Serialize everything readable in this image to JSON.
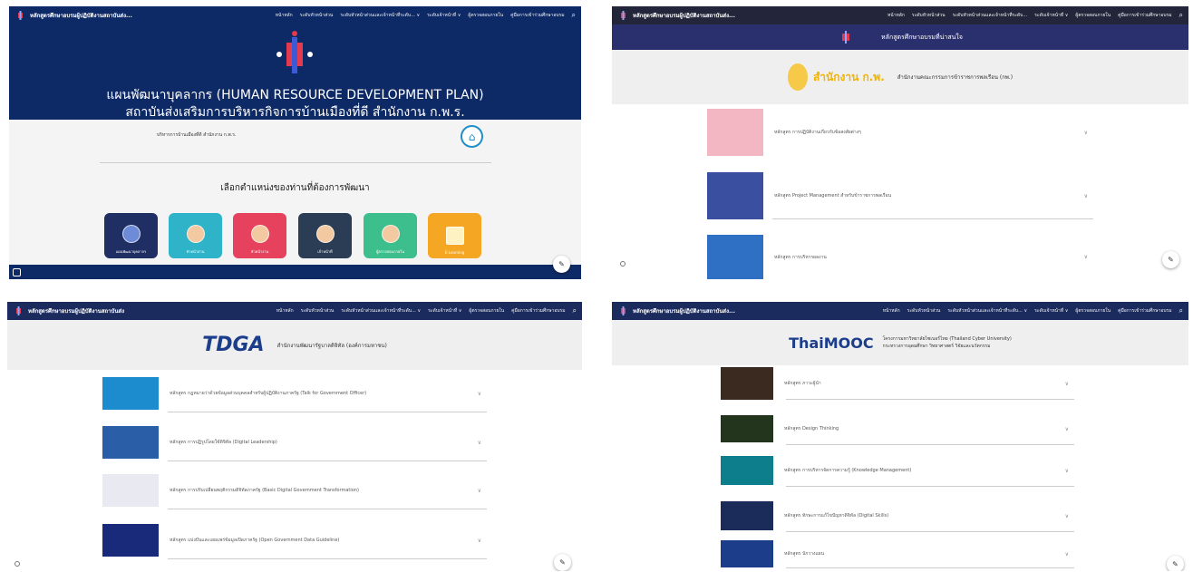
{
  "colors": {
    "hero": "#0e2a66",
    "accent_blue": "#1e8fc7"
  },
  "p1": {
    "site_title": "หลักสูตรศึกษาอบรมผู้ปฏิบัติงานสถาบันส่ง...",
    "nav": [
      "หน้าหลัก",
      "ระดับหัวหน้าส่วน",
      "ระดับหัวหน้าส่วนและเจ้าหน้าที่ระดับ... ∨",
      "ระดับเจ้าหน้าที่ ∨",
      "ผู้ตรวจสอบภายใน",
      "คู่มือการเข้าร่วมศึกษาอบรม"
    ],
    "hero_title": "แผนพัฒนาบุคลากร (HUMAN RESOURCE DEVELOPMENT PLAN)",
    "hero_subtitle": "สถาบันส่งเสริมการบริหารกิจการบ้านเมืองที่ดี สำนักงาน ก.พ.ร.",
    "breadcrumb": "บริหารการบ้านเมืองที่ดี สำนักงาน ก.พ.ร.",
    "pick_title": "เลือกตำแหน่งของท่านที่ต้องการพัฒนา",
    "cards": [
      {
        "label": "แผนพัฒนาบุคลากร",
        "color": "#1f2e63"
      },
      {
        "label": "หัวหน้าส่วน",
        "color": "#2fb3c9"
      },
      {
        "label": "หัวหน้างาน",
        "color": "#e6425e"
      },
      {
        "label": "เจ้าหน้าที่",
        "color": "#2a3d55"
      },
      {
        "label": "ผู้ตรวจสอบภายใน",
        "color": "#3cbf8c"
      },
      {
        "label": "E-Learning",
        "color": "#f5a623"
      }
    ]
  },
  "p2": {
    "site_title": "หลักสูตรศึกษาอบรมผู้ปฏิบัติงานสถาบันส่ง...",
    "nav": [
      "หน้าหลัก",
      "ระดับหัวหน้าส่วน",
      "ระดับหัวหน้าส่วนและเจ้าหน้าที่ระดับ...",
      "ระดับเจ้าหน้าที่ ∨",
      "ผู้ตรวจสอบภายใน",
      "คู่มือการเข้าร่วมศึกษาอบรม"
    ],
    "band_title": "หลักสูตรศึกษาอบรมที่น่าสนใจ",
    "ocsc_logo": "สำนักงาน ก.พ.",
    "org_name": "สำนักงานคณะกรรมการข้าราชการพลเรือน (กพ.)",
    "rows": [
      {
        "title": "หลักสูตร การปฏิบัติงานเกี่ยวกับข้อสงสัยต่างๆ",
        "color": "#f3b7c4"
      },
      {
        "title": "หลักสูตร Project Management สำหรับข้าราชการพลเรือน",
        "color": "#3a4fa0"
      },
      {
        "title": "หลักสูตร การบริหารผลงาน",
        "color": "#2f6fc4"
      }
    ]
  },
  "p3": {
    "site_title": "หลักสูตรศึกษาอบรมผู้ปฏิบัติงานสถาบันส่ง",
    "nav": [
      "หน้าหลัก",
      "ระดับหัวหน้าส่วน",
      "ระดับหัวหน้าส่วนและเจ้าหน้าที่ระดับ... ∨",
      "ระดับเจ้าหน้าที่ ∨",
      "ผู้ตรวจสอบภายใน",
      "คู่มือการเข้าร่วมศึกษาอบรม"
    ],
    "tdga_logo": "TDGA",
    "org_name": "สำนักงานพัฒนารัฐบาลดิจิทัล (องค์การมหาชน)",
    "rows": [
      {
        "title": "หลักสูตร กฎหมายว่าด้วยข้อมูลส่วนบุคคลสำหรับผู้ปฏิบัติงานภาครัฐ (Talk for Government Officer)",
        "color": "#1c8ccf"
      },
      {
        "title": "หลักสูตร การปฏิรูปโดยใช้ดิจิทัล (Digital Leadership)",
        "color": "#2a5fa8"
      },
      {
        "title": "หลักสูตร การปรับเปลี่ยนพฤติกรรมดิจิทัลภาครัฐ (Basic Digital Government Transformation)",
        "color": "#e9e9f2"
      },
      {
        "title": "หลักสูตร แบ่งปันและเผยแพร่ข้อมูลเปิดภาครัฐ (Open Government Data Guideline)",
        "color": "#1a2a7a"
      }
    ]
  },
  "p4": {
    "site_title": "หลักสูตรศึกษาอบรมผู้ปฏิบัติงานสถาบันส่ง...",
    "nav": [
      "หน้าหลัก",
      "ระดับหัวหน้าส่วน",
      "ระดับหัวหน้าส่วนและเจ้าหน้าที่ระดับ... ∨",
      "ระดับเจ้าหน้าที่ ∨",
      "ผู้ตรวจสอบภายใน",
      "คู่มือการเข้าร่วมศึกษาอบรม"
    ],
    "mooc_logo": "ThaiMOOC",
    "org_line1": "โครงการมหาวิทยาลัยไซเบอร์ไทย (Thailand Cyber University)",
    "org_line2": "กระทรวงการอุดมศึกษา วิทยาศาสตร์ วิจัยและนวัตกรรม",
    "rows": [
      {
        "title": "หลักสูตร ภาวะผู้นำ",
        "color": "#3b2a1f"
      },
      {
        "title": "หลักสูตร Design Thinking",
        "color": "#24351d"
      },
      {
        "title": "หลักสูตร การบริหารจัดการความรู้ (Knowledge Management)",
        "color": "#0d7f8c"
      },
      {
        "title": "หลักสูตร ทักษะการแก้ไขปัญหาดิจิทัล (Digital Skills)",
        "color": "#1b2c5a"
      },
      {
        "title": "หลักสูตร นักวางแผน",
        "color": "#1b3d8a"
      }
    ]
  }
}
